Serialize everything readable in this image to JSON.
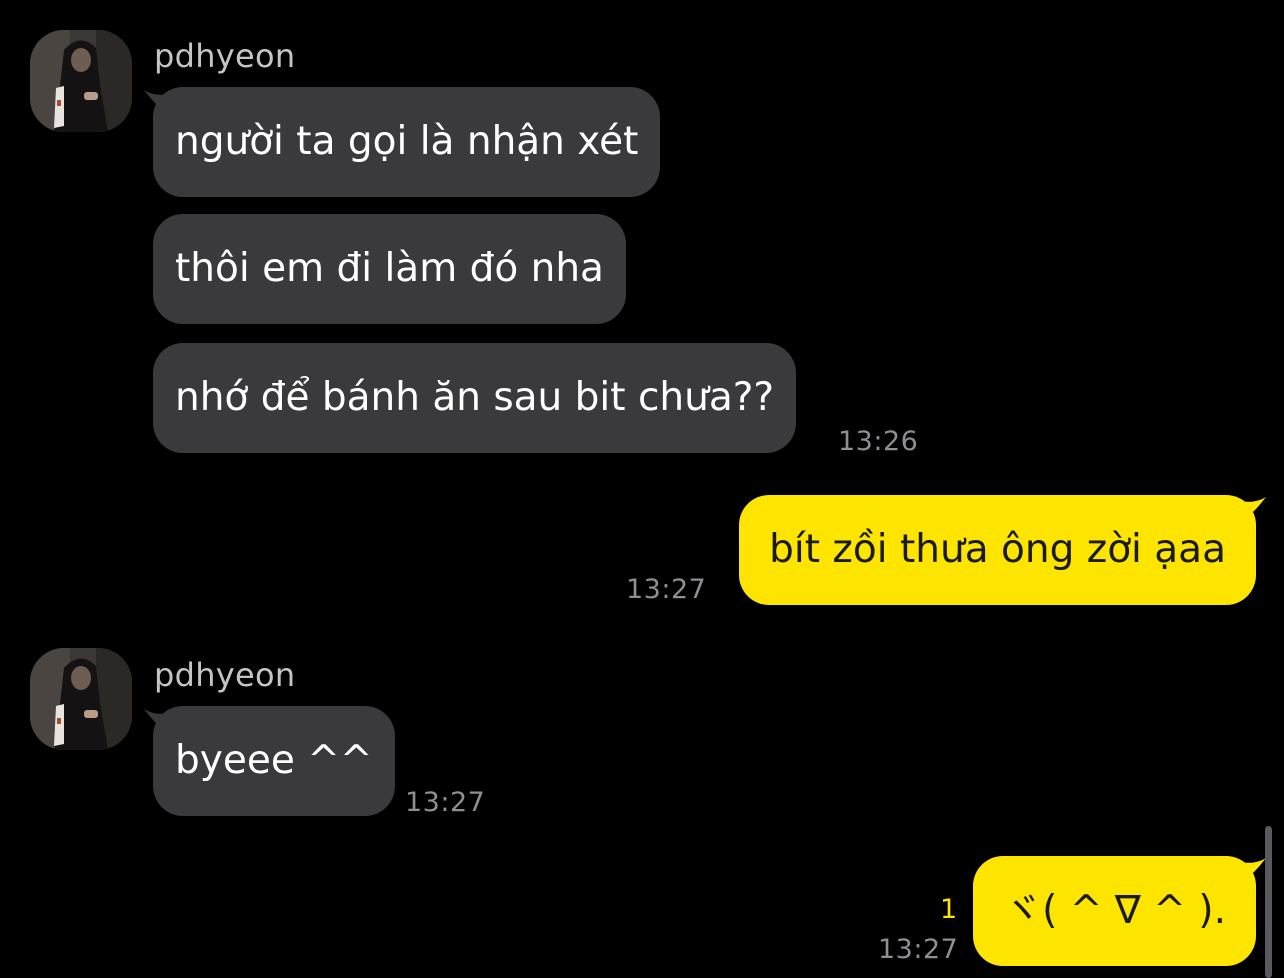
{
  "colors": {
    "background": "#000000",
    "incoming_bubble": "#3a3a3c",
    "outgoing_bubble": "#fee500",
    "timestamp": "#8e8e93",
    "unread_count": "#fee500"
  },
  "groups": [
    {
      "sender": "pdhyeon",
      "avatar_icon": "profile-photo-avatar",
      "messages": [
        "người ta gọi là nhận xét",
        "thôi em đi làm đó nha",
        "nhớ để bánh ăn sau bit chưa??"
      ],
      "time": "13:26"
    },
    {
      "outgoing": true,
      "messages": [
        "bít zồi thưa ông zời ạaa"
      ],
      "time": "13:27"
    },
    {
      "sender": "pdhyeon",
      "avatar_icon": "profile-photo-avatar",
      "messages": [
        "byeee ^^"
      ],
      "time": "13:27"
    },
    {
      "outgoing": true,
      "messages": [
        "ヾ( ^ ∇ ^ )."
      ],
      "unread": "1",
      "time": "13:27"
    }
  ]
}
